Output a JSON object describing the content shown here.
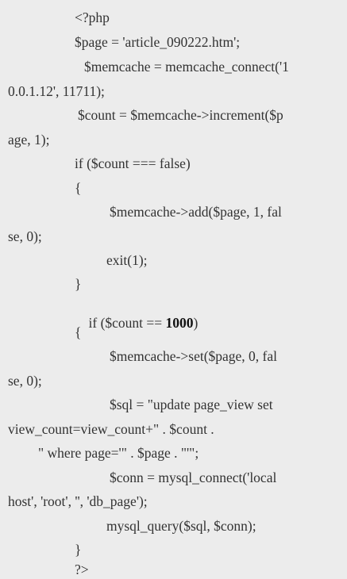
{
  "code": {
    "lines": [
      "<?php",
      "$page = 'article_090222.htm';",
      "$memcache = memcache_connect('1",
      "0.0.1.12', 11711);",
      "$count = $memcache->increment($p",
      "age, 1);",
      "if ($count === false)",
      "{",
      "$memcache->add($page, 1, fal",
      "se, 0);",
      "exit(1);",
      "}",
      "if ($count == ",
      "1000",
      ")",
      "{",
      "$memcache->set($page, 0, fal",
      "se, 0);",
      "$sql = \"update page_view set",
      "view_count=view_count+\" . $count .",
      "\" where page='\" . $page . \"'\";",
      "$conn = mysql_connect('local",
      "host', 'root', '', 'db_page');",
      "mysql_query($sql, $conn);",
      "}",
      "?>"
    ]
  }
}
